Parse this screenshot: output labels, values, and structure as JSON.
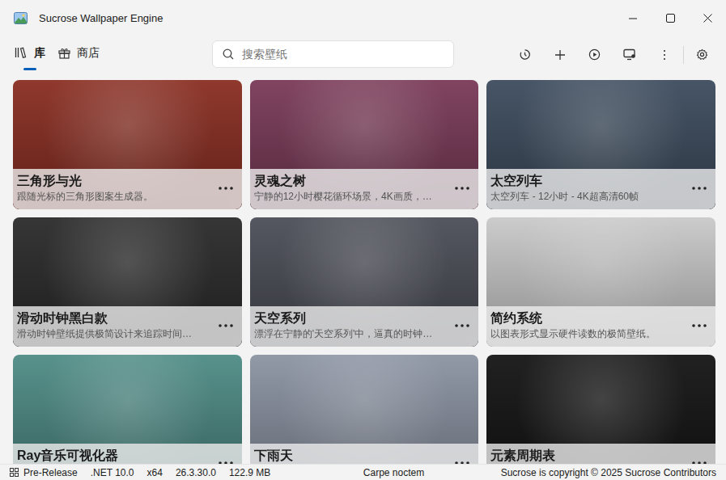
{
  "window": {
    "title": "Sucrose Wallpaper Engine"
  },
  "nav": {
    "tabs": [
      {
        "label": "库",
        "selected": true
      },
      {
        "label": "商店",
        "selected": false
      }
    ]
  },
  "search": {
    "placeholder": "搜索壁纸"
  },
  "wallpapers": [
    {
      "title": "三角形与光",
      "description": "跟随光标的三角形图案生成器。",
      "color": "#8a2e22"
    },
    {
      "title": "灵魂之树",
      "description": "宁静的12小时樱花循环场景，4K画质，…",
      "color": "#7a3a58"
    },
    {
      "title": "太空列车",
      "description": "太空列车 - 12小时 - 4K超高清60帧",
      "color": "#3d4c5e"
    },
    {
      "title": "滑动时钟黑白款",
      "description": "滑动时钟壁纸提供极简设计来追踪时间…",
      "color": "#2b2b2b"
    },
    {
      "title": "天空系列",
      "description": "漂浮在宁静的'天空系列'中，逼真的时钟…",
      "color": "#4c4e58"
    },
    {
      "title": "简约系统",
      "description": "以图表形式显示硬件读数的极简壁纸。",
      "color": "#c9c9c9"
    },
    {
      "title": "Ray音乐可视化器",
      "color": "#4f8c86"
    },
    {
      "title": "下雨天",
      "color": "#8c94a3"
    },
    {
      "title": "元素周期表",
      "color": "#151515"
    }
  ],
  "status_bar": {
    "left": [
      "Pre-Release",
      ".NET 10.0",
      "x64",
      "26.3.30.0",
      "122.9 MB"
    ],
    "center": "Carpe noctem",
    "right": "Sucrose is copyright © 2025 Sucrose Contributors"
  }
}
